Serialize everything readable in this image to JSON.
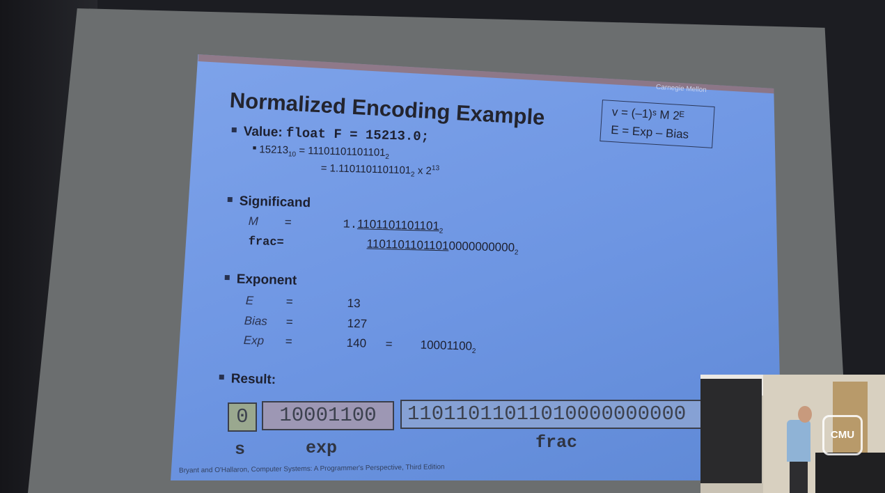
{
  "slide": {
    "corner_label": "Carnegie Mellon",
    "title": "Normalized Encoding Example",
    "formula": {
      "line1": "v = (–1)ˢ M 2ᴱ",
      "line2": "E  =  Exp – Bias"
    },
    "value_section": {
      "label": "Value: ",
      "code": "float F = 15213.0;",
      "sub1_left": "15213",
      "sub1_left_base": "10",
      "sub1_right": " = 11101101101101",
      "sub1_right_base": "2",
      "sub2": "= 1.1101101101101",
      "sub2_base": "2",
      "sub2_tail": " x 2",
      "sub2_exp": "13"
    },
    "significand": {
      "label": "Significand",
      "m_name": "M",
      "eq": "=",
      "m_prefix": "1.",
      "m_value": "1101101101101",
      "m_base": "2",
      "frac_name": "frac=",
      "frac_underlined": "1101101101101",
      "frac_rest": "0000000000",
      "frac_base": "2"
    },
    "exponent": {
      "label": "Exponent",
      "rows": [
        {
          "name": "E",
          "eq": "=",
          "value": "13"
        },
        {
          "name": "Bias",
          "eq": "=",
          "value": "127"
        },
        {
          "name": "Exp",
          "eq": "=",
          "value": "140",
          "eq2": "=",
          "binary": "10001100",
          "base": "2"
        }
      ]
    },
    "result": {
      "label": "Result:",
      "s_bits": "0",
      "exp_bits": "10001100",
      "frac_bits": "11011011011010000000000",
      "s_label": "s",
      "exp_label": "exp",
      "frac_label": "frac"
    },
    "footer": "Bryant and O'Hallaron, Computer Systems: A Programmer's Perspective, Third Edition"
  },
  "webcam": {
    "logo_text": "CMU"
  }
}
